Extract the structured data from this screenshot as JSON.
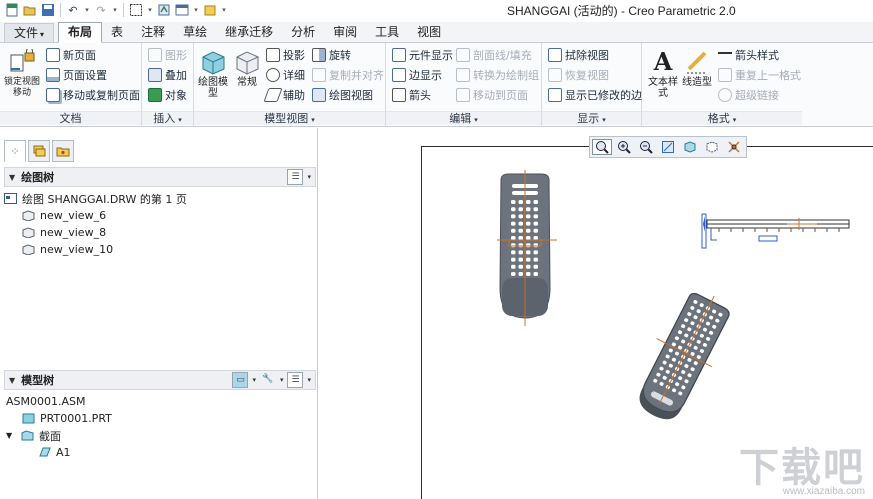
{
  "window": {
    "title": "SHANGGAI (活动的) - Creo Parametric 2.0"
  },
  "quick_access": {
    "icons": [
      "new-icon",
      "open-icon",
      "save-icon",
      "undo-icon",
      "redo-icon",
      "select-box-icon",
      "regenerate-icon",
      "window-icon",
      "close-icon",
      "customize-icon"
    ]
  },
  "menu": {
    "tabs": [
      {
        "label": "文件",
        "dropdown": "▾"
      },
      {
        "label": "布局"
      },
      {
        "label": "表"
      },
      {
        "label": "注释"
      },
      {
        "label": "草绘"
      },
      {
        "label": "继承迁移"
      },
      {
        "label": "分析"
      },
      {
        "label": "审阅"
      },
      {
        "label": "工具"
      },
      {
        "label": "视图"
      }
    ],
    "active": "布局"
  },
  "ribbon": {
    "document": {
      "label": "文档",
      "lock_view": "锁定视图移动",
      "new_page": "新页面",
      "page_setup": "页面设置",
      "move_copy_page": "移动或复制页面"
    },
    "insert": {
      "label": "插入",
      "graphic": "图形",
      "overlay": "叠加",
      "object": "对象"
    },
    "model_views": {
      "label": "模型视图",
      "drawing_model": "绘图模型",
      "general": "常规",
      "projection": "投影",
      "detailed": "详细",
      "auxiliary": "辅助",
      "revolve": "旋转",
      "copy_align": "复制并对齐",
      "drawing_view": "绘图视图"
    },
    "edit": {
      "label": "编辑",
      "component_display": "元件显示",
      "edge_display": "边显示",
      "arrow": "箭头",
      "hatch_fill": "剖面线/填充",
      "convert_to_drawing_group": "转换为绘制组",
      "move_to_page": "移动到页面"
    },
    "display": {
      "label": "显示",
      "erase_view": "拭除视图",
      "resume_view": "恢复视图",
      "show_modified_edges": "显示已修改的边"
    },
    "format": {
      "label": "格式",
      "text_style": "文本样式",
      "line_style": "线造型",
      "arrow_style": "箭头样式",
      "repeat_last_format": "重复上一格式",
      "hyperlink": "超级链接"
    },
    "caret": "▾"
  },
  "left_panel": {
    "tabs": [
      "tree-icon",
      "layers-icon",
      "favorites-icon"
    ],
    "drawing_tree": {
      "header": "绘图树",
      "root": "绘图 SHANGGAI.DRW 的第 1 页",
      "items": [
        "new_view_6",
        "new_view_8",
        "new_view_10"
      ]
    },
    "model_tree": {
      "header": "模型树",
      "root": "ASM0001.ASM",
      "part": "PRT0001.PRT",
      "section_group": "截面",
      "section": "A1"
    }
  },
  "view_toolbar": {
    "icons": [
      "zoom-to-fit-icon",
      "zoom-in-icon",
      "zoom-out-icon",
      "repaint-icon",
      "display-style-icon",
      "shaded-icon",
      "datum-display-icon"
    ]
  },
  "watermark": {
    "text": "下载吧",
    "url": "www.xiazaiba.com"
  },
  "colors": {
    "accent": "#2d6db5",
    "part_gray": "#6c737d",
    "part_dark": "#4a5058",
    "section_orange": "#c8702a",
    "datum_blue": "#2f5fc9"
  }
}
